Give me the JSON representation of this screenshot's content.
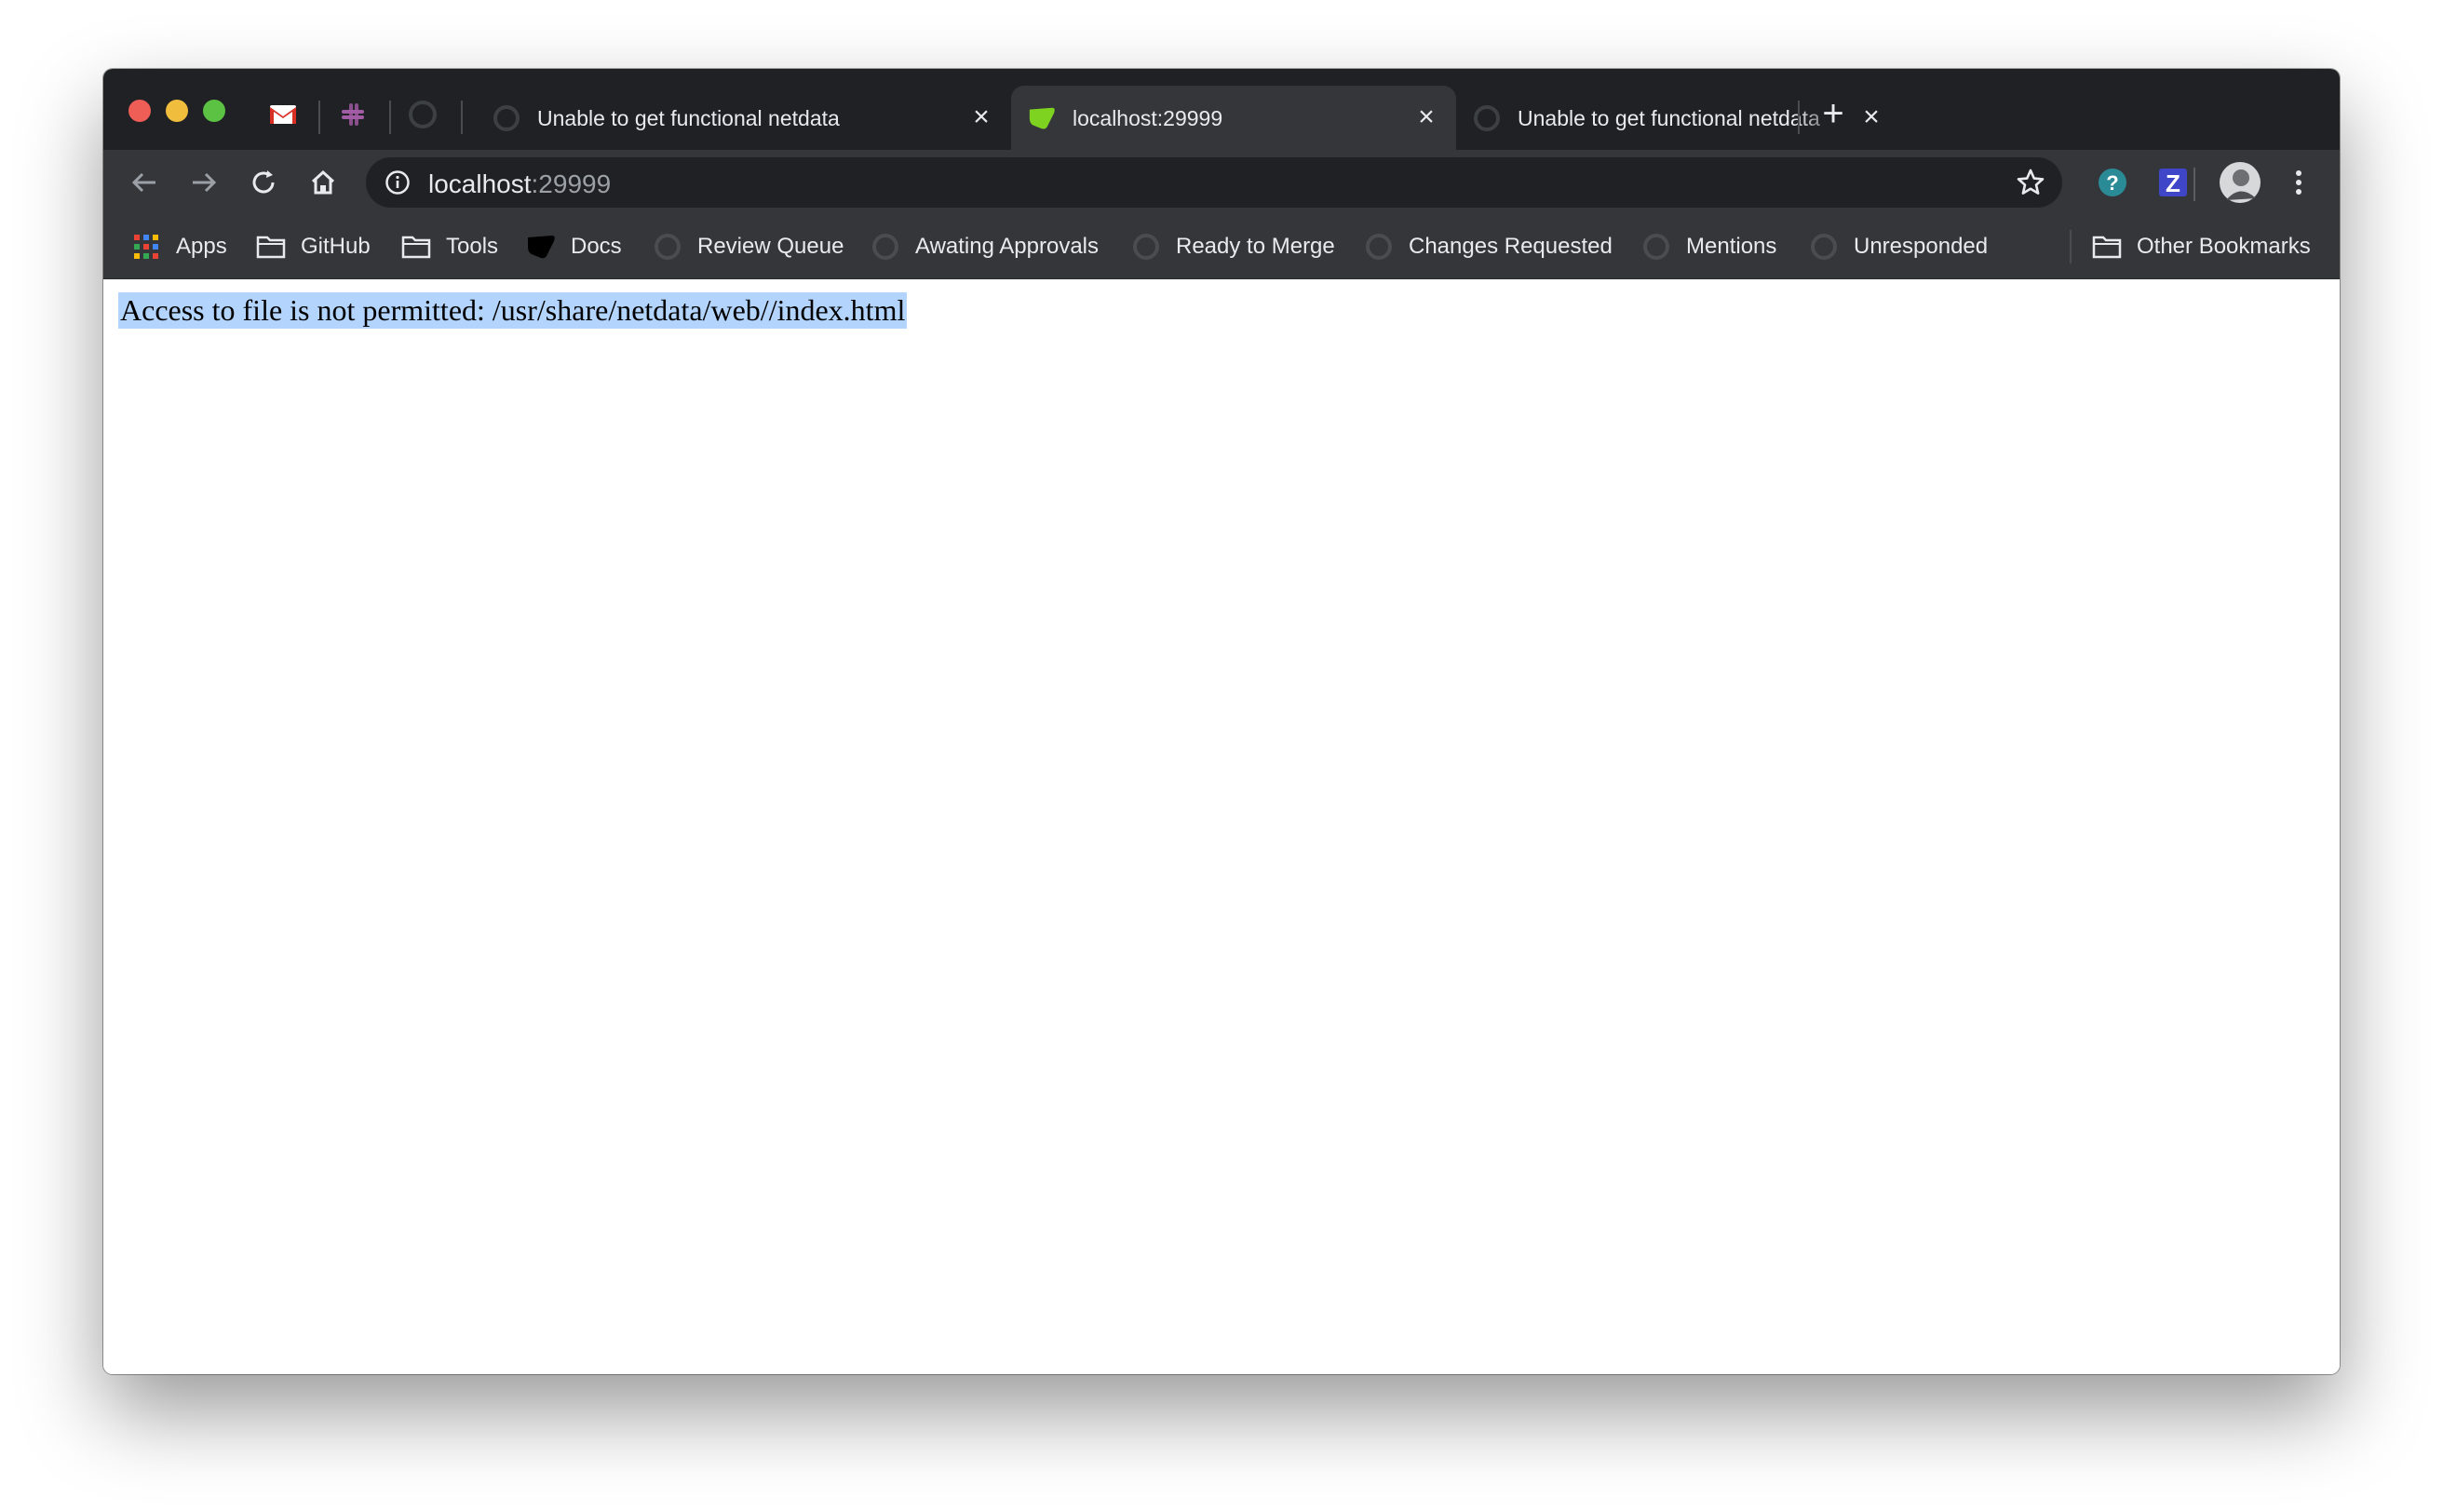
{
  "tabs": [
    {
      "title": "Unable to get functional netdata",
      "active": false
    },
    {
      "title": "localhost:29999",
      "active": true
    },
    {
      "title": "Unable to get functional netdata",
      "active": false
    }
  ],
  "address": {
    "host": "localhost",
    "port": ":29999"
  },
  "bookmarks": {
    "apps": "Apps",
    "github": "GitHub",
    "tools": "Tools",
    "docs": "Docs",
    "review_queue": "Review Queue",
    "awaiting_approvals": "Awating Approvals",
    "ready_to_merge": "Ready to Merge",
    "changes_requested": "Changes Requested",
    "mentions": "Mentions",
    "unresponded": "Unresponded",
    "other": "Other Bookmarks"
  },
  "page": {
    "message": "Access to file is not permitted: /usr/share/netdata/web//index.html"
  },
  "icons": {
    "gmail": "gmail-icon",
    "slack": "slack-icon",
    "github": "github-icon",
    "netdata": "netdata-icon",
    "folder": "folder-icon",
    "apps": "apps-grid-icon",
    "star": "star-icon",
    "extension_help": "help-extension-icon",
    "extension_z": "z-extension-icon",
    "avatar": "avatar-icon",
    "menu": "kebab-menu-icon"
  },
  "colors": {
    "tabstrip": "#202124",
    "toolbar": "#35363a",
    "omnibox": "#202124",
    "text": "#e8eaed",
    "selection": "#b3d4fd",
    "netdata_green": "#7ed321"
  }
}
